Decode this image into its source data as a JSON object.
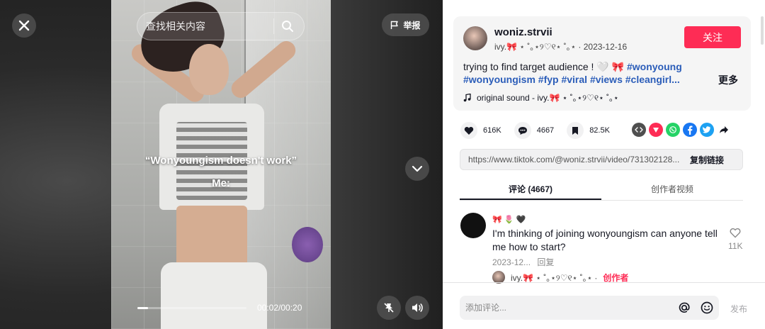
{
  "video": {
    "search_placeholder": "查找相关内容",
    "report_label": "举报",
    "caption_line1": "“Wonyoungism doesn't work”",
    "caption_line2": "Me:",
    "time": "00:02/00:20",
    "progress": 0.1
  },
  "post": {
    "username": "woniz.strvii",
    "meta": "ivy.🎀 ⋆ ˚｡⋆୨♡୧⋆ ˚｡⋆ · 2023-12-16",
    "follow_label": "关注",
    "description_text": "trying to find target audience ! 🤍 🎀 ",
    "hashtags": "#wonyoung #wonyoungism #fyp #viral #views #cleangirl...",
    "more_label": "更多",
    "sound": "original sound - ivy.🎀 ⋆ ˚｡⋆୨♡୧⋆ ˚｡⋆"
  },
  "stats": {
    "likes": "616K",
    "comments": "4667",
    "saves": "82.5K"
  },
  "link": {
    "url": "https://www.tiktok.com/@woniz.strvii/video/731302128...",
    "copy_label": "复制链接"
  },
  "tabs": [
    {
      "label": "评论 (4667)"
    },
    {
      "label": "创作者视频"
    }
  ],
  "comment": {
    "author": "🎀 🌷 🖤",
    "text": "I'm thinking of joining wonyoungism can anyone tell me how to start?",
    "date": "2023-12...",
    "reply_label": "回复",
    "likes": "11K",
    "reply_author": "ivy.🎀 ⋆ ˚｡⋆୨♡୧⋆ ˚｡⋆ ·",
    "creator_label": "创作者"
  },
  "composer": {
    "placeholder": "添加评论...",
    "post_label": "发布"
  },
  "colors": {
    "accent": "#fe2c55",
    "hashtag": "#2b5db9"
  }
}
